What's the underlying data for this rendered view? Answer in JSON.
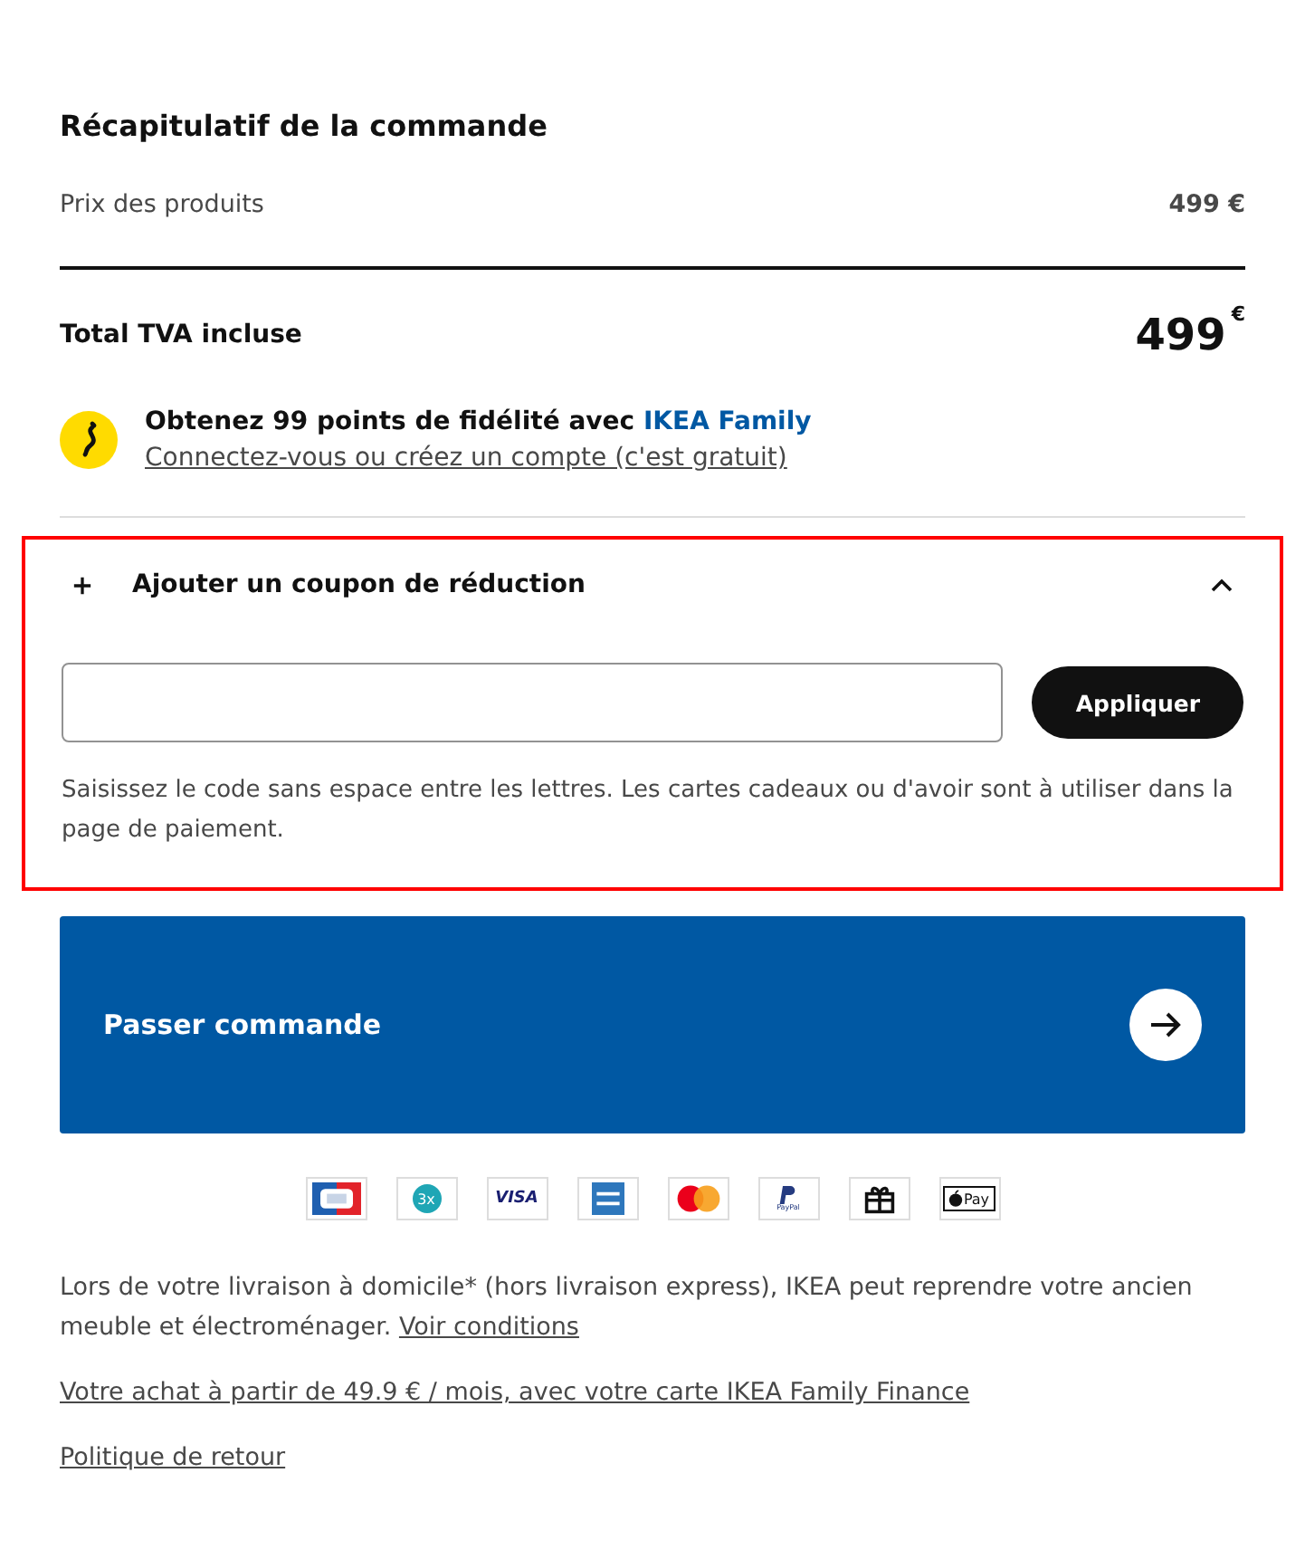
{
  "summary": {
    "title": "Récapitulatif de la commande",
    "subtotal": {
      "label": "Prix des produits",
      "value": "499 €"
    },
    "total": {
      "label": "Total TVA incluse",
      "amount": "499",
      "currency": "€"
    }
  },
  "loyalty": {
    "text": "Obtenez 99 points de fidélité avec",
    "brand": "IKEA Family",
    "link": "Connectez-vous ou créez un compte (c'est gratuit)"
  },
  "coupon": {
    "title": "Ajouter un coupon de réduction",
    "expanded": true,
    "highlighted": true,
    "button": "Appliquer",
    "hint": "Saisissez le code sans espace entre les lettres. Les cartes cadeaux ou d'avoir sont à utiliser dans la page de paiement."
  },
  "checkout_button": {
    "label": "Passer commande"
  },
  "payment_methods": [
    {
      "kind": "cb"
    },
    {
      "kind": "installments",
      "label": "3x"
    },
    {
      "kind": "visa",
      "label": "VISA"
    },
    {
      "kind": "amex"
    },
    {
      "kind": "mastercard"
    },
    {
      "kind": "paypal",
      "label": "PayPal"
    },
    {
      "kind": "gift"
    },
    {
      "kind": "applepay",
      "label": "Pay"
    }
  ],
  "notes": [
    {
      "text": "Lors de votre livraison à domicile* (hors livraison express), IKEA peut reprendre votre ancien meuble et électroménager.",
      "link": "Voir conditions"
    },
    {
      "link": "Votre achat à partir de 49.9 € / mois, avec votre carte IKEA Family Finance"
    },
    {
      "link": "Politique de retour"
    }
  ]
}
